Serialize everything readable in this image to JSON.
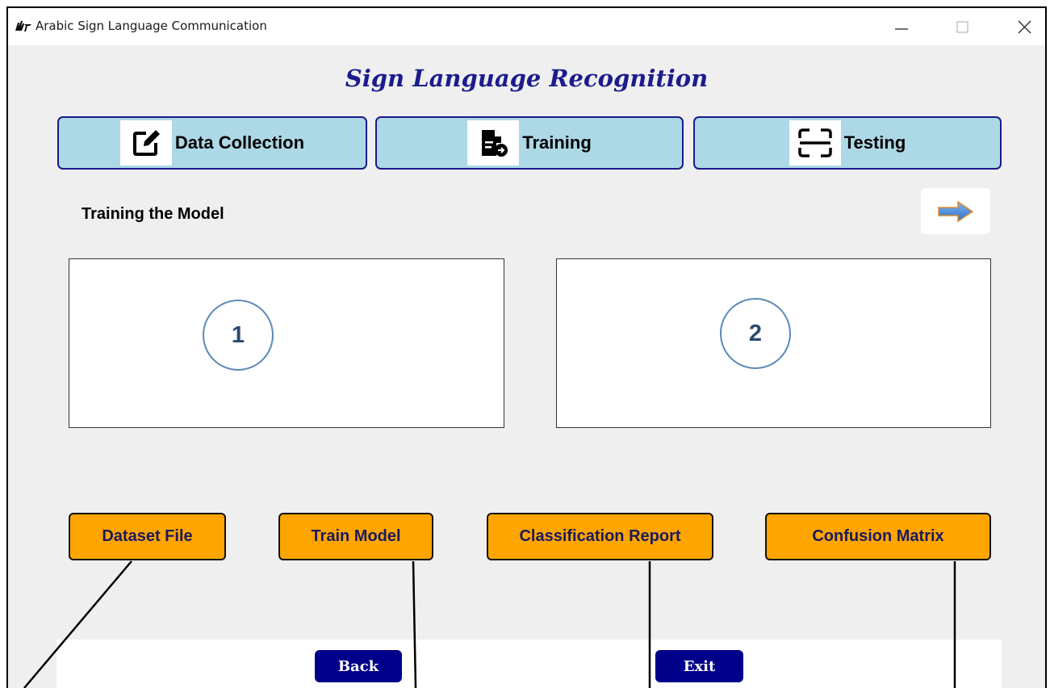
{
  "window": {
    "title": "Arabic Sign Language Communication",
    "app_icon": "hand-sign-icon",
    "controls": [
      "minimize-icon",
      "maximize-icon",
      "close-icon"
    ]
  },
  "header": {
    "title": "Sign Language Recognition"
  },
  "nav": {
    "items": [
      {
        "label": "Data Collection",
        "icon": "edit-icon"
      },
      {
        "label": "Training",
        "icon": "file-train-icon"
      },
      {
        "label": "Testing",
        "icon": "scan-icon"
      }
    ]
  },
  "section": {
    "title": "Training the Model",
    "next_icon": "right-arrow-icon"
  },
  "panels": [
    {
      "number": "1"
    },
    {
      "number": "2"
    }
  ],
  "actions": {
    "dataset_file": "Dataset File",
    "train_model": "Train Model",
    "classification_report": "Classification Report",
    "confusion_matrix": "Confusion Matrix"
  },
  "footer": {
    "back": "Back",
    "exit": "Exit"
  },
  "colors": {
    "nav_bg": "#add8e6",
    "nav_border": "#1a1a8c",
    "action_bg": "#ffa500",
    "title_color": "#1c1c8e",
    "footer_btn_bg": "#00008b"
  }
}
